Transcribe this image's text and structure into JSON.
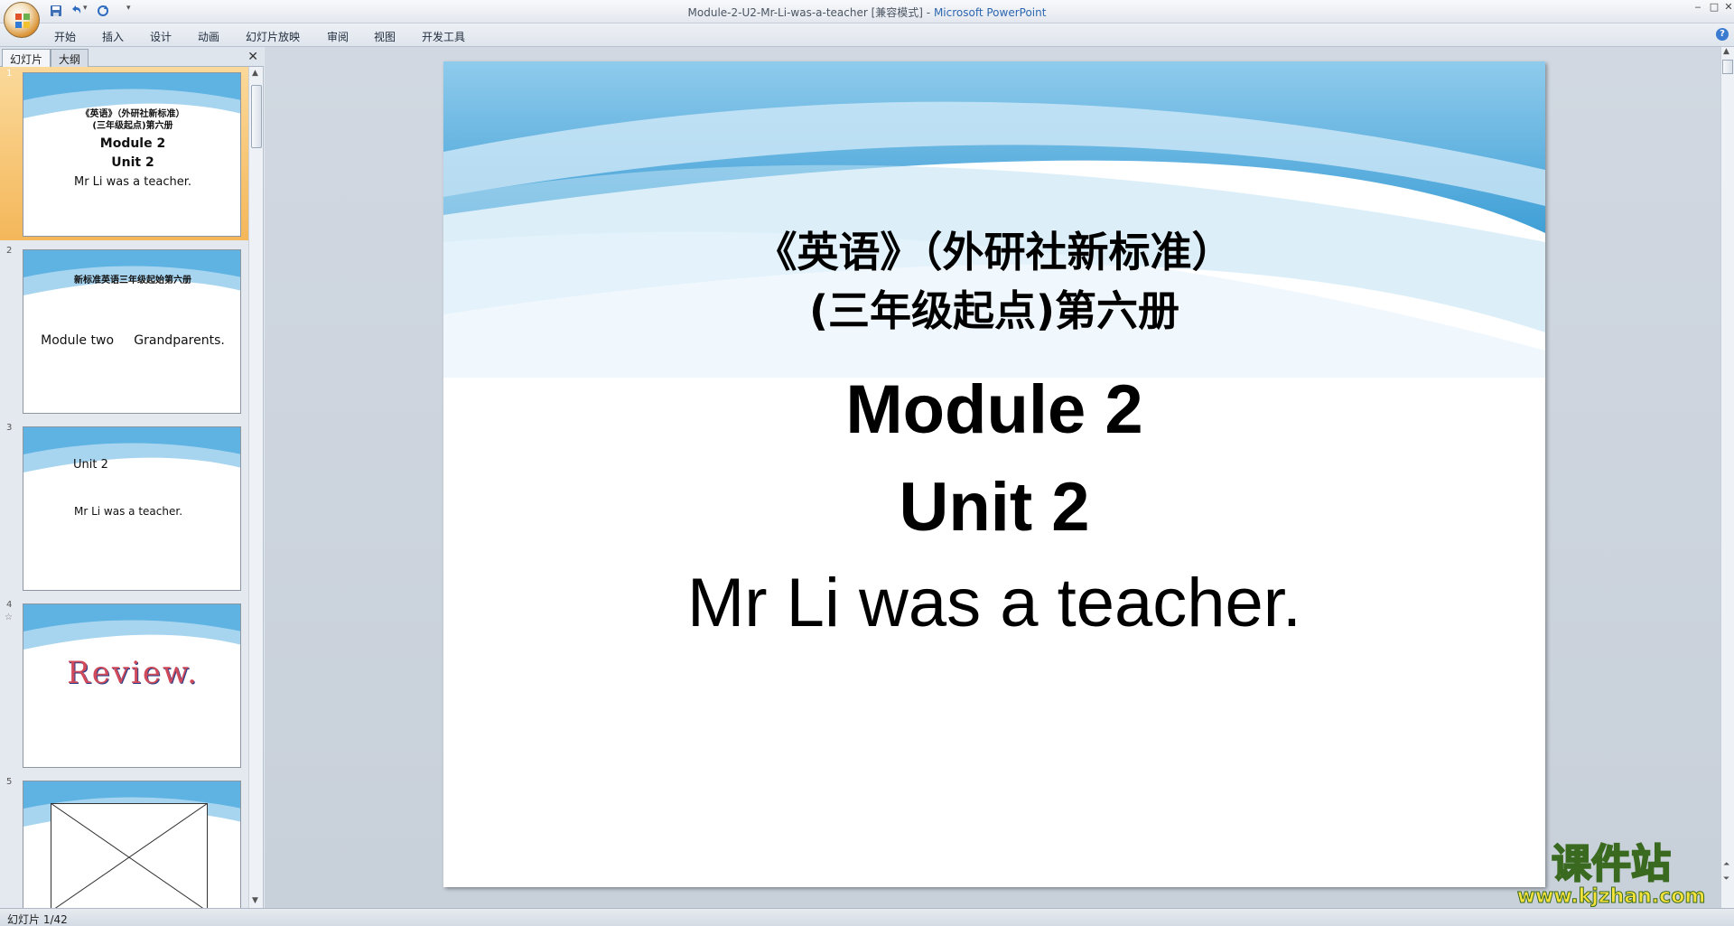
{
  "titlebar": {
    "document": "Module-2-U2-Mr-Li-was-a-teacher [兼容模式]",
    "separator": " - ",
    "app": "Microsoft PowerPoint"
  },
  "ribbon": {
    "tabs": [
      "开始",
      "插入",
      "设计",
      "动画",
      "幻灯片放映",
      "审阅",
      "视图",
      "开发工具"
    ]
  },
  "pane": {
    "tabs": [
      "幻灯片",
      "大纲"
    ],
    "close": "✕"
  },
  "thumbnails": [
    {
      "number": "1",
      "lines": [
        "《英语》（外研社新标准）",
        "(三年级起点)第六册",
        "Module 2",
        "Unit 2",
        "Mr Li was a teacher."
      ]
    },
    {
      "number": "2",
      "lines": [
        "新标准英语三年级起始第六册",
        "Module two     Grandparents."
      ]
    },
    {
      "number": "3",
      "lines": [
        "Unit 2",
        "Mr Li was  a teacher."
      ]
    },
    {
      "number": "4",
      "star": "☆",
      "lines": [
        "Review."
      ]
    },
    {
      "number": "5",
      "lines": []
    }
  ],
  "slide": {
    "title_line1": "《英语》（外研社新标准）",
    "title_line2": "(三年级起点)第六册",
    "module": "Module 2",
    "unit": "Unit 2",
    "subtitle": "Mr Li was a teacher."
  },
  "status": {
    "slide_indicator": "幻灯片 1/42"
  },
  "watermark": {
    "brand": "课件站",
    "url": "www.kjzhan.com"
  },
  "colors": {
    "wave_blue": "#4aa8dc",
    "selected_thumb": "#f4b75a",
    "title_app": "#2d67b0"
  }
}
